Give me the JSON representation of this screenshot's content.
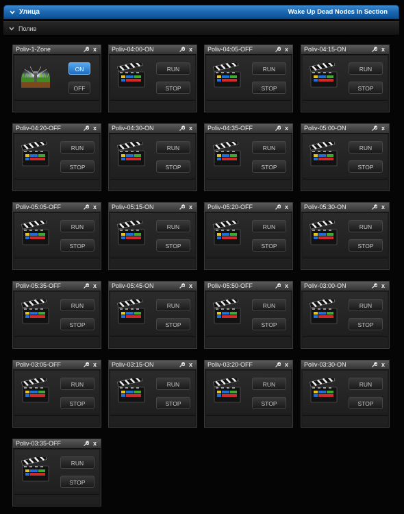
{
  "section": {
    "title": "Улица",
    "wake_label": "Wake Up Dead Nodes In Section",
    "sub_title": "Полив"
  },
  "zone_widget": {
    "name": "Poliv-1-Zone",
    "on_label": "ON",
    "off_label": "OFF",
    "icon": "sprinkler-icon",
    "active": "ON"
  },
  "scene_widgets": [
    {
      "name": "Poliv-04:00-ON",
      "run": "RUN",
      "stop": "STOP"
    },
    {
      "name": "Poliv-04:05-OFF",
      "run": "RUN",
      "stop": "STOP"
    },
    {
      "name": "Poliv-04:15-ON",
      "run": "RUN",
      "stop": "STOP"
    },
    {
      "name": "Poliv-04:20-OFF",
      "run": "RUN",
      "stop": "STOP"
    },
    {
      "name": "Poliv-04:30-ON",
      "run": "RUN",
      "stop": "STOP"
    },
    {
      "name": "Poliv-04:35-OFF",
      "run": "RUN",
      "stop": "STOP"
    },
    {
      "name": "Poliv-05:00-ON",
      "run": "RUN",
      "stop": "STOP"
    },
    {
      "name": "Poliv-05:05-OFF",
      "run": "RUN",
      "stop": "STOP"
    },
    {
      "name": "Poliv-05:15-ON",
      "run": "RUN",
      "stop": "STOP"
    },
    {
      "name": "Poliv-05:20-OFF",
      "run": "RUN",
      "stop": "STOP"
    },
    {
      "name": "Poliv-05:30-ON",
      "run": "RUN",
      "stop": "STOP"
    },
    {
      "name": "Poliv-05:35-OFF",
      "run": "RUN",
      "stop": "STOP"
    },
    {
      "name": "Poliv-05:45-ON",
      "run": "RUN",
      "stop": "STOP"
    },
    {
      "name": "Poliv-05:50-OFF",
      "run": "RUN",
      "stop": "STOP"
    },
    {
      "name": "Poliv-03:00-ON",
      "run": "RUN",
      "stop": "STOP"
    },
    {
      "name": "Poliv-03:05-OFF",
      "run": "RUN",
      "stop": "STOP"
    },
    {
      "name": "Poliv-03:15-ON",
      "run": "RUN",
      "stop": "STOP"
    },
    {
      "name": "Poliv-03:20-OFF",
      "run": "RUN",
      "stop": "STOP"
    },
    {
      "name": "Poliv-03:30-ON",
      "run": "RUN",
      "stop": "STOP"
    },
    {
      "name": "Poliv-03:35-OFF",
      "run": "RUN",
      "stop": "STOP"
    }
  ],
  "icons": {
    "widget_tool": "wrench-icon",
    "widget_close": "close-icon",
    "close_glyph": "x",
    "scene": "clapperboard-icon",
    "collapse": "chevron-down-icon"
  },
  "colors": {
    "section_bar": "#1d6ab3",
    "on_button": "#1b6dc0"
  }
}
